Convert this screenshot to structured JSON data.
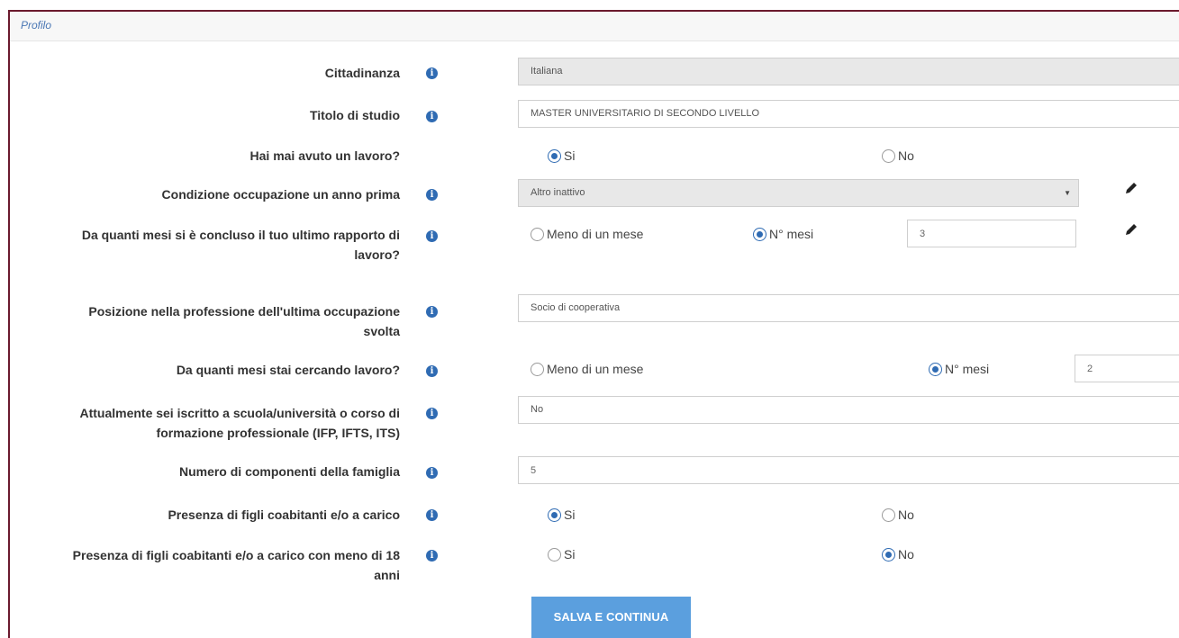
{
  "panel": {
    "title": "Profilo"
  },
  "fields": {
    "cittadinanza": {
      "label": "Cittadinanza",
      "value": "Italiana"
    },
    "titolo_studio": {
      "label": "Titolo di studio",
      "value": "MASTER UNIVERSITARIO DI SECONDO LIVELLO"
    },
    "lavoro": {
      "label": "Hai mai avuto un lavoro?",
      "opt_yes": "Si",
      "opt_no": "No",
      "selected": "Si"
    },
    "condizione": {
      "label": "Condizione occupazione un anno prima",
      "value": "Altro inattivo"
    },
    "mesi_concluso": {
      "label_line1": "Da quanti mesi si è concluso il tuo ultimo rapporto di",
      "label_line2": "lavoro?",
      "opt_less": "Meno di un mese",
      "opt_months": "N° mesi",
      "selected": "N° mesi",
      "value": "3"
    },
    "posizione": {
      "label_line1": "Posizione nella professione dell'ultima occupazione",
      "label_line2": "svolta",
      "value": "Socio di cooperativa"
    },
    "mesi_cercando": {
      "label": "Da quanti mesi stai cercando lavoro?",
      "opt_less": "Meno di un mese",
      "opt_months": "N° mesi",
      "selected": "N° mesi",
      "value": "2"
    },
    "iscritto": {
      "label_line1": "Attualmente sei iscritto a scuola/università o corso di",
      "label_line2": "formazione professionale (IFP, IFTS, ITS)",
      "value": "No"
    },
    "componenti": {
      "label": "Numero di componenti della famiglia",
      "value": "5"
    },
    "figli": {
      "label": "Presenza di figli coabitanti e/o a carico",
      "opt_yes": "Si",
      "opt_no": "No",
      "selected": "Si"
    },
    "figli_18": {
      "label_line1": "Presenza di figli coabitanti e/o a carico con meno di 18",
      "label_line2": "anni",
      "opt_yes": "Si",
      "opt_no": "No",
      "selected": "No"
    }
  },
  "icons": {
    "info": "info-icon",
    "edit": "pencil-icon",
    "caret": "caret-down-icon"
  },
  "colors": {
    "border": "#6b1a2e",
    "accent": "#2f6bb3",
    "button": "#5b9fde"
  },
  "actions": {
    "save_label": "SALVA E CONTINUA"
  }
}
